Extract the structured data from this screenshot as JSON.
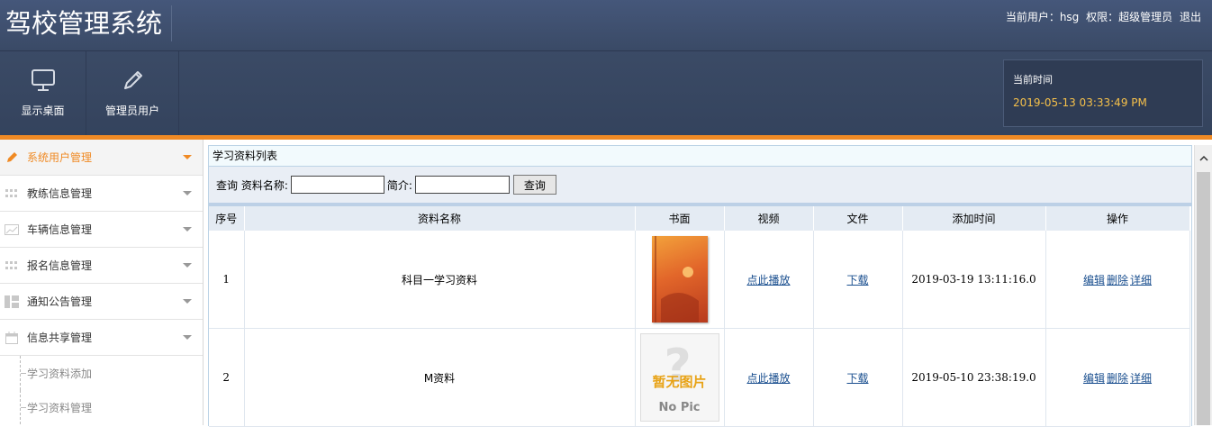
{
  "header": {
    "app_title": "驾校管理系统",
    "user_label": "当前用户：hsg",
    "role_label": "权限：超级管理员",
    "logout_label": "退出",
    "nav": [
      {
        "label": "显示桌面",
        "icon": "monitor-icon"
      },
      {
        "label": "管理员用户",
        "icon": "pencil-icon"
      }
    ],
    "time_label": "当前时间",
    "time_value": "2019-05-13 03:33:49 PM"
  },
  "colors": {
    "header_bg": "#3f4f6b",
    "accent": "#f08a24",
    "time_value": "#f5c04a",
    "link": "#1a4f8f"
  },
  "sidebar": {
    "items": [
      {
        "label": "系统用户管理",
        "icon": "pencil-icon",
        "active": true
      },
      {
        "label": "教练信息管理",
        "icon": "grid-icon"
      },
      {
        "label": "车辆信息管理",
        "icon": "image-icon"
      },
      {
        "label": "报名信息管理",
        "icon": "grid-icon"
      },
      {
        "label": "通知公告管理",
        "icon": "layout-icon"
      },
      {
        "label": "信息共享管理",
        "icon": "calendar-icon"
      }
    ],
    "sub_items": [
      {
        "label": "学习资料添加"
      },
      {
        "label": "学习资料管理"
      }
    ]
  },
  "main": {
    "panel_title": "学习资料列表",
    "search": {
      "label_name": "查询 资料名称:",
      "label_intro": "简介:",
      "button_label": "查询",
      "name_value": "",
      "intro_value": ""
    },
    "table": {
      "headers": [
        "序号",
        "资料名称",
        "书面",
        "视频",
        "文件",
        "添加时间",
        "操作"
      ],
      "rows": [
        {
          "index": "1",
          "name": "科目一学习资料",
          "cover": "book-cover-image",
          "video_link": "点此播放",
          "file_link": "下载",
          "added": "2019-03-19 13:11:16.0",
          "ops": [
            "编辑",
            "删除",
            "详细"
          ]
        },
        {
          "index": "2",
          "name": "M资料",
          "cover": "no-pic-placeholder",
          "nopic_cn": "暂无图片",
          "nopic_en": "No Pic",
          "video_link": "点此播放",
          "file_link": "下载",
          "added": "2019-05-10 23:38:19.0",
          "ops": [
            "编辑",
            "删除",
            "详细"
          ]
        }
      ]
    }
  }
}
